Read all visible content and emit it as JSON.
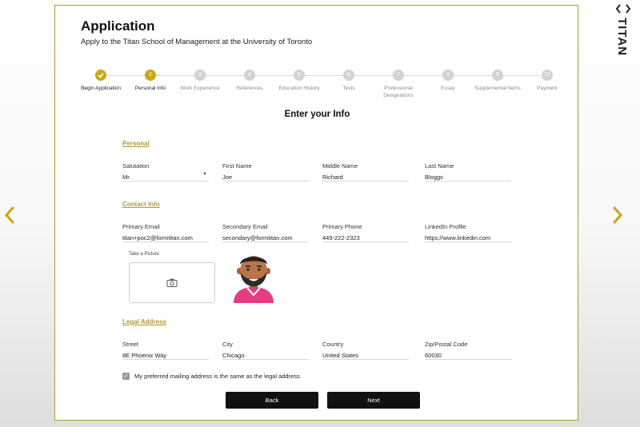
{
  "header": {
    "title": "Application",
    "subtitle": "Apply to the Titan School of Management at the University of Toronto"
  },
  "brand": {
    "logo_text": "TITAN",
    "accent": "#c9a814"
  },
  "stepper": {
    "steps": [
      {
        "num": "1",
        "label": "Begin Application",
        "state": "done"
      },
      {
        "num": "2",
        "label": "Personal Info",
        "state": "active"
      },
      {
        "num": "3",
        "label": "Work Experience",
        "state": "pending"
      },
      {
        "num": "4",
        "label": "References",
        "state": "pending"
      },
      {
        "num": "5",
        "label": "Education History",
        "state": "pending"
      },
      {
        "num": "6",
        "label": "Tests",
        "state": "pending"
      },
      {
        "num": "7",
        "label": "Professional Designations",
        "state": "pending"
      },
      {
        "num": "8",
        "label": "Essay",
        "state": "pending"
      },
      {
        "num": "9",
        "label": "Supplemental Items",
        "state": "pending"
      },
      {
        "num": "10",
        "label": "Payment",
        "state": "pending"
      }
    ]
  },
  "form": {
    "title": "Enter your Info",
    "personal": {
      "heading": "Personal",
      "salutation": {
        "label": "Salutation",
        "value": "Mr."
      },
      "first_name": {
        "label": "First Name",
        "value": "Joe"
      },
      "middle_name": {
        "label": "Middle Name",
        "value": "Richard"
      },
      "last_name": {
        "label": "Last Name",
        "value": "Bloggs"
      }
    },
    "contact": {
      "heading": "Contact Info",
      "primary_email": {
        "label": "Primary Email",
        "value": "titan+poc2@formtitan.com"
      },
      "secondary_email": {
        "label": "Secondary Email",
        "value": "secondary@formtitan.com"
      },
      "primary_phone": {
        "label": "Primary Phone",
        "value": "449-222-2323"
      },
      "linkedin": {
        "label": "LinkedIn Profile",
        "value": "https://www.linkedin.com"
      },
      "picture_label": "Take a Picture"
    },
    "legal_address": {
      "heading": "Legal Address",
      "street": {
        "label": "Street",
        "value": "8E Phoenix Way"
      },
      "city": {
        "label": "City",
        "value": "Chicago"
      },
      "country": {
        "label": "Country",
        "value": "United States"
      },
      "zip": {
        "label": "Zip/Postal Code",
        "value": "60030"
      }
    },
    "mailing_same": {
      "label": "My preferred mailing address is the same as the legal address",
      "checked": true
    },
    "back_label": "Back",
    "next_label": "Next"
  },
  "icons": {
    "check": "check-icon",
    "dropdown": "chevron-down-icon",
    "camera": "camera-icon",
    "prev": "chevron-left-icon",
    "next": "chevron-right-icon"
  }
}
